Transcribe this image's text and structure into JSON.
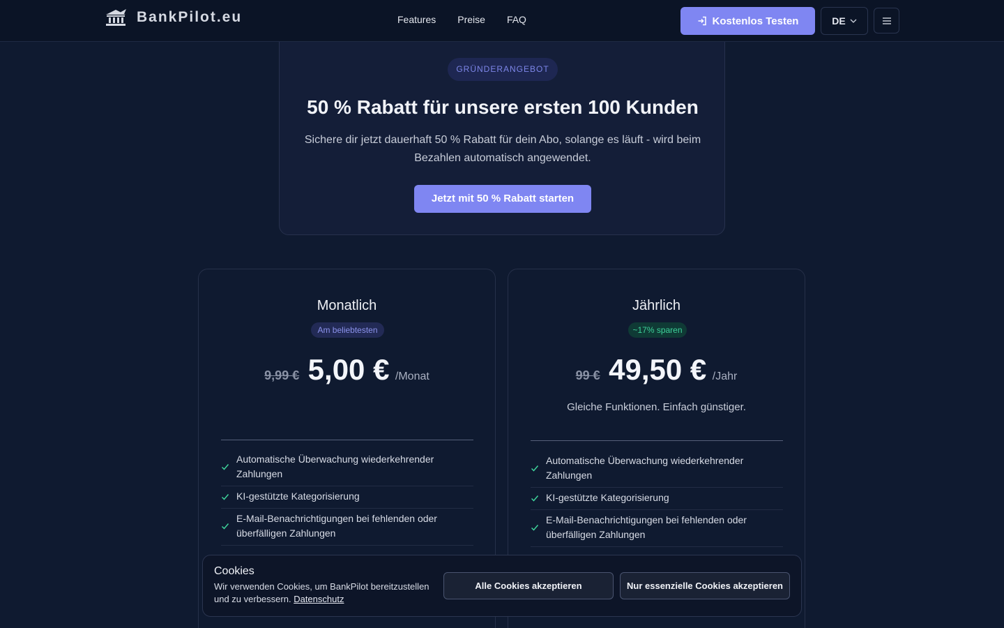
{
  "header": {
    "brand": "BankPilot.eu",
    "nav": [
      "Features",
      "Preise",
      "FAQ"
    ],
    "cta_label": "Kostenlos Testen",
    "language": "DE"
  },
  "offer": {
    "badge": "GRÜNDERANGEBOT",
    "title": "50 % Rabatt für unsere ersten 100 Kunden",
    "description": "Sichere dir jetzt dauerhaft 50 % Rabatt für dein Abo, solange es läuft - wird beim Bezahlen automatisch angewendet.",
    "button": "Jetzt mit 50 % Rabatt starten"
  },
  "plans": [
    {
      "title": "Monatlich",
      "badge": "Am beliebtesten",
      "old_price": "9,99 €",
      "price": "5,00 €",
      "period": "/Monat",
      "subtitle": "",
      "features": [
        "Automatische Überwachung wiederkehrender Zahlungen",
        "KI-gestützte Kategorisierung",
        "E-Mail-Benachrichtigungen bei fehlenden oder überfälligen Zahlungen"
      ]
    },
    {
      "title": "Jährlich",
      "badge": "~17% sparen",
      "old_price": "99 €",
      "price": "49,50 €",
      "period": "/Jahr",
      "subtitle": "Gleiche Funktionen. Einfach günstiger.",
      "features": [
        "Automatische Überwachung wiederkehrender Zahlungen",
        "KI-gestützte Kategorisierung",
        "E-Mail-Benachrichtigungen bei fehlenden oder überfälligen Zahlungen"
      ]
    }
  ],
  "cookie": {
    "title": "Cookies",
    "text": "Wir verwenden Cookies, um BankPilot bereitzustellen und zu verbessern.",
    "link": "Datenschutz",
    "accept_all": "Alle Cookies akzeptieren",
    "accept_essential": "Nur essenzielle Cookies akzeptieren"
  },
  "colors": {
    "background": "#0f1a30",
    "accent": "#7f86f2",
    "success": "#3ed29a"
  },
  "icons": {
    "logo": "bank-building-icon",
    "cta": "login-arrow-icon",
    "language": "chevron-down-icon",
    "menu": "hamburger-menu-icon",
    "feature": "check-icon"
  }
}
